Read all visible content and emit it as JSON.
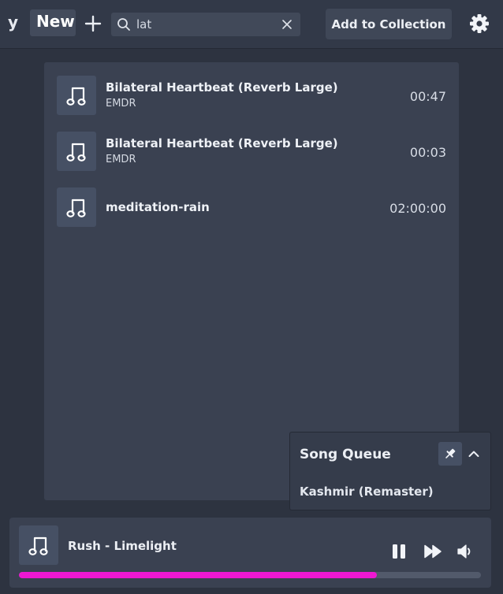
{
  "header": {
    "partial_tab_label": "y",
    "active_tab_label": "New",
    "search": {
      "value": "lat",
      "placeholder": ""
    },
    "add_to_collection_label": "Add to Collection"
  },
  "results": [
    {
      "title": "Bilateral Heartbeat (Reverb Large)",
      "artist": "EMDR",
      "duration": "00:47"
    },
    {
      "title": "Bilateral Heartbeat (Reverb Large)",
      "artist": "EMDR",
      "duration": "00:03"
    },
    {
      "title": "meditation-rain",
      "artist": "",
      "duration": "02:00:00"
    }
  ],
  "queue": {
    "title": "Song Queue",
    "items": [
      "Kashmir (Remaster)"
    ]
  },
  "player": {
    "now_playing": "Rush - Limelight",
    "progress_fraction": 0.775
  },
  "colors": {
    "accent": "#ee18d2",
    "background": "#2d3340",
    "panel": "#3a4151"
  },
  "icons": [
    "plus-icon",
    "search-icon",
    "close-icon",
    "gear-icon",
    "music-note-icon",
    "pin-icon",
    "chevron-up-icon",
    "pause-icon",
    "fast-forward-icon",
    "volume-icon"
  ]
}
